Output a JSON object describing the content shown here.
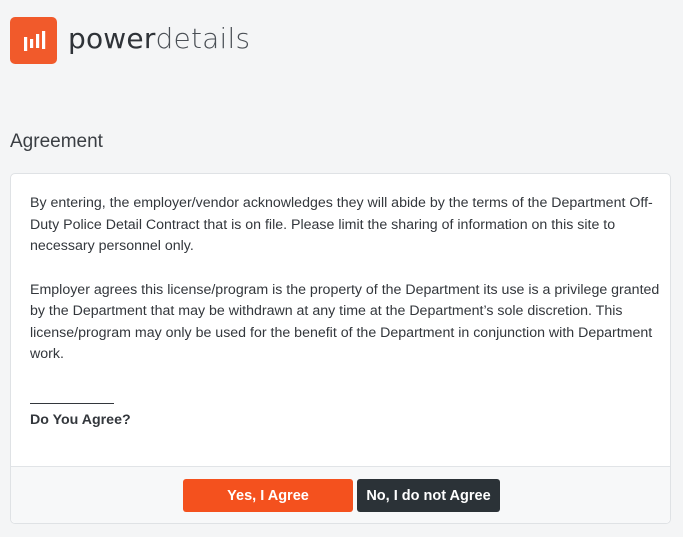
{
  "brand": {
    "name_part1": "power",
    "name_part2": "details",
    "accent_color": "#f15a2b",
    "logo_icon": "bar-chart-icon"
  },
  "page": {
    "title": "Agreement"
  },
  "agreement": {
    "paragraph1": "By entering, the employer/vendor acknowledges they will abide by the terms of the Department Off-Duty Police Detail Contract that is on file. Please limit the sharing of information on this site to necessary personnel only.",
    "paragraph2": "Employer agrees this license/program is the property of the Department its use is a privilege granted by the Department that may be withdrawn at any time at the Department’s sole discretion. This license/program may only be used for the benefit of the Department in conjunction with Department work.",
    "question": "Do You Agree?"
  },
  "actions": {
    "agree_label": "Yes, I Agree",
    "disagree_label": "No, I do not Agree",
    "agree_color": "#f4511e",
    "disagree_color": "#2b3237"
  }
}
